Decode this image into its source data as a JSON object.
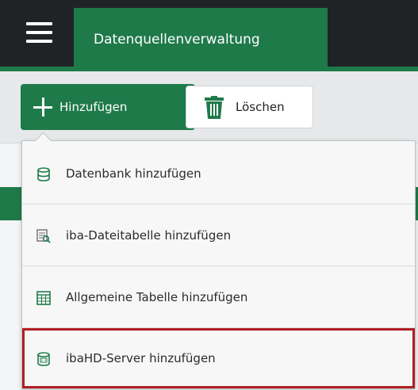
{
  "header": {
    "title": "Datenquellenverwaltung",
    "menu_icon": "hamburger-menu-icon"
  },
  "toolbar": {
    "add_label": "Hinzufügen",
    "add_icon": "plus-icon",
    "delete_label": "Löschen",
    "delete_icon": "trash-icon"
  },
  "dropdown": {
    "items": [
      {
        "label": "Datenbank hinzufügen",
        "icon": "database-icon"
      },
      {
        "label": "iba-Dateitabelle hinzufügen",
        "icon": "file-table-icon"
      },
      {
        "label": "Allgemeine Tabelle hinzufügen",
        "icon": "table-icon"
      },
      {
        "label": "ibaHD-Server hinzufügen",
        "icon": "hd-server-icon",
        "highlighted": true
      }
    ]
  },
  "colors": {
    "accent": "#1f7a4a",
    "topbar": "#1f2326",
    "highlight_border": "#b01f24"
  }
}
